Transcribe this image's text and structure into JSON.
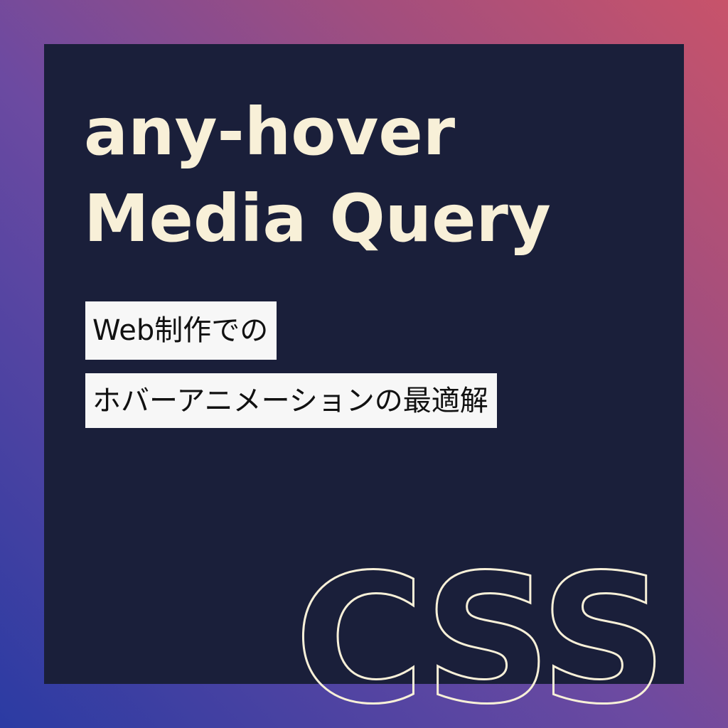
{
  "title": {
    "line1": "any-hover",
    "line2": "Media Query"
  },
  "subtitle": {
    "line1": "Web制作での",
    "line2": "ホバーアニメーションの最適解"
  },
  "badge": "CSS",
  "colors": {
    "panel": "#1a1f3a",
    "title_text": "#f8f0d8",
    "tag_background": "#f7f7f7",
    "tag_text": "#111111",
    "gradient_start": "#2b3ba3",
    "gradient_end": "#c8536a"
  }
}
